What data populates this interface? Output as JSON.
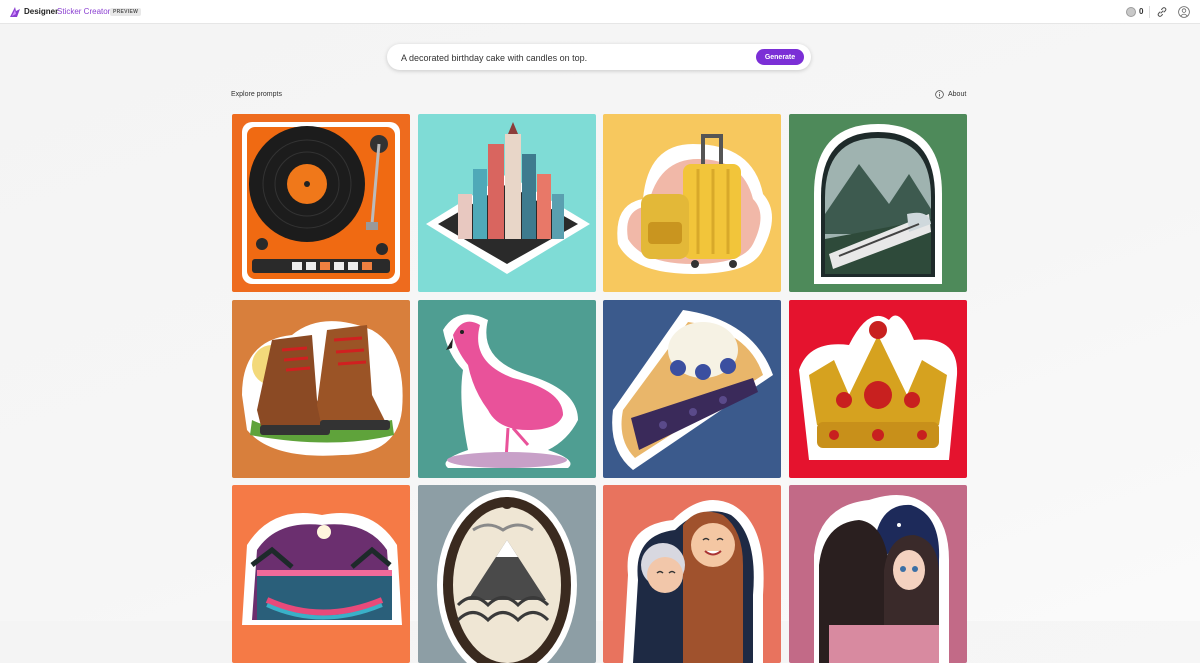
{
  "header": {
    "brand": "Designer",
    "product": "Sticker Creator",
    "badge": "PREVIEW",
    "coins": "0"
  },
  "search": {
    "value": "A decorated birthday cake with candles on top.",
    "generate_label": "Generate"
  },
  "section": {
    "explore_label": "Explore prompts",
    "about_label": "About"
  },
  "tiles": [
    {
      "subject": "turntable-sticker",
      "bg": "#ee6b1e"
    },
    {
      "subject": "isometric-city-sticker",
      "bg": "#7fdcd6"
    },
    {
      "subject": "luggage-sticker",
      "bg": "#f7c85e"
    },
    {
      "subject": "mountain-train-sticker",
      "bg": "#4e8a5a"
    },
    {
      "subject": "hiking-boots-sticker",
      "bg": "#d87f3c"
    },
    {
      "subject": "flamingo-sticker",
      "bg": "#4f9e92"
    },
    {
      "subject": "blueberry-pie-sticker",
      "bg": "#3b5a8c"
    },
    {
      "subject": "crown-sticker",
      "bg": "#e5132e"
    },
    {
      "subject": "hammock-sunset-sticker",
      "bg": "#f57a46"
    },
    {
      "subject": "mountain-wave-medallion-sticker",
      "bg": "#8d9ea5"
    },
    {
      "subject": "hugging-women-sticker",
      "bg": "#e8735e"
    },
    {
      "subject": "anime-girls-sticker",
      "bg": "#c26a87"
    }
  ]
}
